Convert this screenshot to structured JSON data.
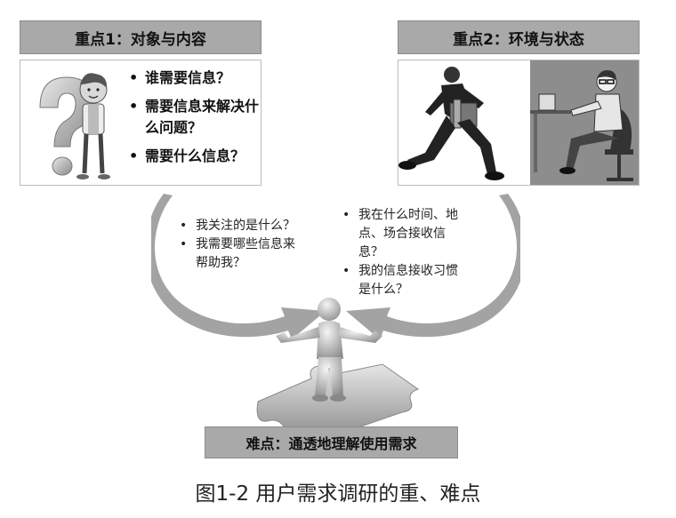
{
  "left_section": {
    "header": "重点1：对象与内容",
    "questions": [
      "谁需要信息？",
      "需要信息来解决什么问题？",
      "需要什么信息？"
    ],
    "illustration_icon": "question-mark-person-icon"
  },
  "right_section": {
    "header": "重点2：环境与状态",
    "illustration_icons": [
      "running-businessman-icon",
      "person-at-desk-icon"
    ]
  },
  "left_callout": [
    "我关注的是什么？",
    "我需要哪些信息来帮助我？"
  ],
  "right_callout": [
    "我在什么时间、地点、场合接收信息？",
    "我的信息接收习惯是什么？"
  ],
  "center_icon": "puzzle-figure-icon",
  "footer_label": "难点：通透地理解使用需求",
  "caption": "图1-2 用户需求调研的重、难点",
  "colors": {
    "header_bg": "#a9a9a9",
    "arrow": "#a3a3a3"
  }
}
